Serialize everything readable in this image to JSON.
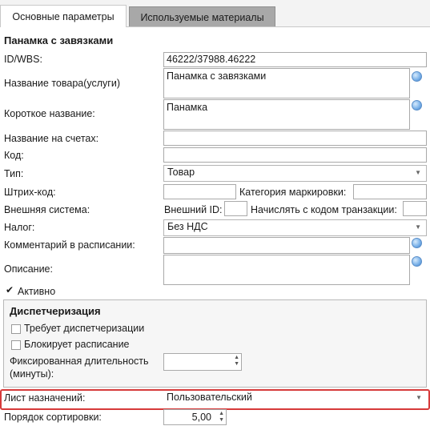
{
  "tabs": [
    "Основные параметры",
    "Используемые материалы"
  ],
  "section_title": "Панамка с завязками",
  "fields": {
    "id_wbs": {
      "label": "ID/WBS:",
      "value": "46222/37988.46222"
    },
    "product_name": {
      "label": "Название товара(услуги)",
      "value": "Панамка с завязками"
    },
    "short_name": {
      "label": "Короткое название:",
      "value": "Панамка"
    },
    "invoice_name": {
      "label": "Название на счетах:",
      "value": ""
    },
    "code": {
      "label": "Код:",
      "value": ""
    },
    "type": {
      "label": "Тип:",
      "value": "Товар"
    },
    "barcode": {
      "label": "Штрих-код:",
      "value": ""
    },
    "marking_category": {
      "label": "Категория маркировки:",
      "value": ""
    },
    "external_system": {
      "label": "Внешняя система:"
    },
    "external_id": {
      "label": "Внешний ID:",
      "value": ""
    },
    "accrue_with_code": {
      "label": "Начислять с кодом транзакции:",
      "value": ""
    },
    "tax": {
      "label": "Налог:",
      "value": "Без НДС"
    },
    "schedule_comment": {
      "label": "Комментарий в расписании:",
      "value": ""
    },
    "description": {
      "label": "Описание:",
      "value": ""
    },
    "active": {
      "label": "Активно",
      "checked": true
    }
  },
  "dispatch": {
    "title": "Диспетчеризация",
    "requires_dispatch": {
      "label": "Требует диспетчеризации",
      "checked": false
    },
    "blocks_schedule": {
      "label": "Блокирует расписание",
      "checked": false
    },
    "fixed_duration": {
      "label_line1": "Фиксированная длительность",
      "label_line2": "(минуты):",
      "value": ""
    }
  },
  "assignment_sheet": {
    "label": "Лист назначений:",
    "value": "Пользовательский"
  },
  "sort_order": {
    "label": "Порядок сортировки:",
    "value": "5,00"
  },
  "colors": {
    "highlight": "#d63a3a",
    "globe": "#3f7fc8"
  }
}
